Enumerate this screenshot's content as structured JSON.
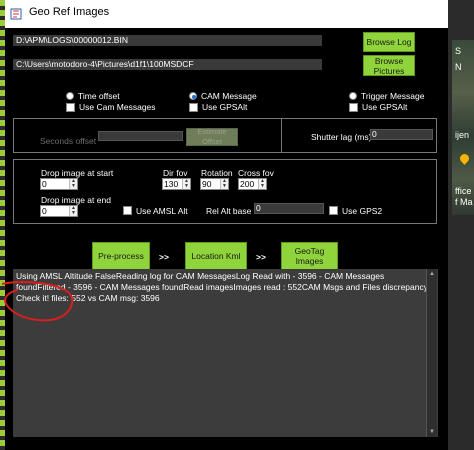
{
  "window": {
    "title": "Geo Ref Images"
  },
  "paths": {
    "log_path": "D:\\APM\\LOGS\\00000012.BIN",
    "pictures_path": "C:\\Users\\motodoro-4\\Pictures\\d1f1\\100MSDCF"
  },
  "buttons": {
    "browse_log": "Browse Log",
    "browse_pictures": "Browse Pictures",
    "estimate_offset": "Estimate Offset",
    "preprocess": "Pre-process",
    "location_kml": "Location Kml",
    "geotag_images": "GeoTag Images"
  },
  "mode": {
    "time_offset": "Time offset",
    "cam_message": "CAM Message",
    "trigger_message": "Trigger Message",
    "use_cam_messages": "Use Cam Messages",
    "use_gpsalt_1": "Use GPSAlt",
    "use_gpsalt_2": "Use GPSAlt",
    "selected": "cam_message"
  },
  "offset": {
    "seconds_offset_label": "Seconds offset",
    "shutter_lag_label": "Shutter lag (ms)",
    "shutter_lag_value": "0"
  },
  "params": {
    "drop_start_label": "Drop image at start",
    "drop_start_value": "0",
    "drop_end_label": "Drop image at end",
    "drop_end_value": "0",
    "dir_fov_label": "Dir fov",
    "dir_fov_value": "130",
    "rotation_label": "Rotation",
    "rotation_value": "90",
    "cross_fov_label": "Cross fov",
    "cross_fov_value": "200",
    "use_amsl_alt": "Use AMSL Alt",
    "rel_alt_base_label": "Rel Alt base",
    "rel_alt_base_value": "0",
    "use_gps2": "Use GPS2"
  },
  "arrows": {
    "a1": ">>",
    "a2": ">>"
  },
  "log": {
    "text": "Using AMSL Altitude FalseReading log for CAM MessagesLog Read with - 3596 - CAM Messages foundFiltered - 3596 - CAM Messages foundRead imagesImages read : 552CAM Msgs and Files discrepancy. Check it! files: 552 vs CAM msg: 3596"
  },
  "map_labels": [
    "S",
    "N",
    "ijen",
    "ffice",
    "f Ma"
  ],
  "colors": {
    "accent_green": "#8fd43b",
    "annotation": "#d81e1e",
    "background": "#000000"
  }
}
